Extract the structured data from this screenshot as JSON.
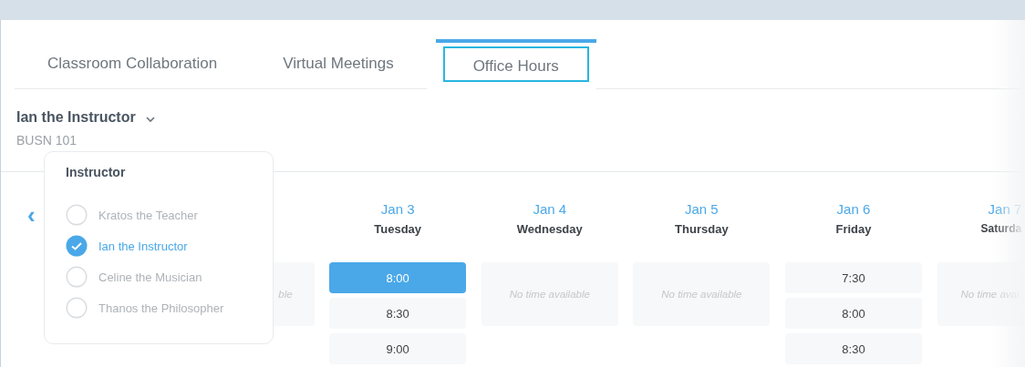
{
  "tabs": [
    {
      "label": "Classroom Collaboration",
      "selected": false
    },
    {
      "label": "Virtual Meetings",
      "selected": false
    },
    {
      "label": "Office Hours",
      "selected": true
    }
  ],
  "selector": {
    "name": "Ian the Instructor",
    "course": "BUSN 101"
  },
  "popup": {
    "title": "Instructor",
    "options": [
      {
        "label": "Kratos the Teacher",
        "selected": false
      },
      {
        "label": "Ian the Instructor",
        "selected": true
      },
      {
        "label": "Celine the Musician",
        "selected": false
      },
      {
        "label": "Thanos the Philosopher",
        "selected": false
      }
    ]
  },
  "prev": "‹",
  "days": [
    {
      "kind": "none",
      "note": "ble"
    },
    {
      "kind": "slots",
      "date": "Jan 3",
      "weekday": "Tuesday",
      "slots": [
        {
          "time": "8:00",
          "selected": true
        },
        {
          "time": "8:30",
          "selected": false
        },
        {
          "time": "9:00",
          "selected": false
        }
      ]
    },
    {
      "kind": "none",
      "date": "Jan 4",
      "weekday": "Wednesday",
      "note": "No time available"
    },
    {
      "kind": "none",
      "date": "Jan 5",
      "weekday": "Thursday",
      "note": "No time available"
    },
    {
      "kind": "slots",
      "date": "Jan 6",
      "weekday": "Friday",
      "slots": [
        {
          "time": "7:30",
          "selected": false
        },
        {
          "time": "8:00",
          "selected": false
        },
        {
          "time": "8:30",
          "selected": false
        }
      ]
    },
    {
      "kind": "none",
      "date": "Jan 7",
      "weekday": "Saturda",
      "note": "No time avai"
    }
  ]
}
